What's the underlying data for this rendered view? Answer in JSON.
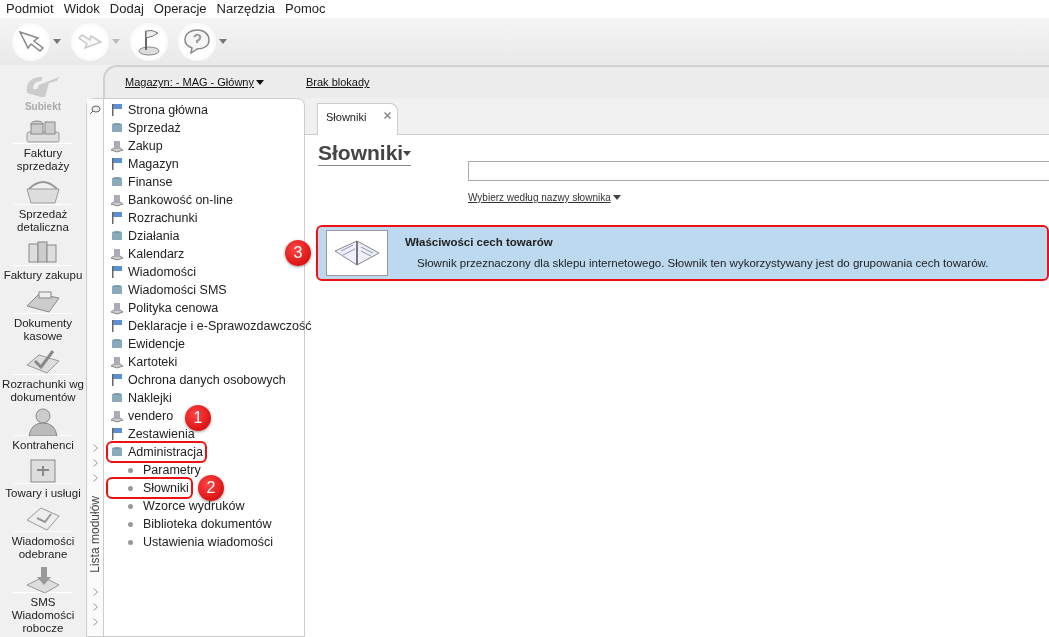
{
  "menu": [
    {
      "label": "Podmiot"
    },
    {
      "label": "Widok"
    },
    {
      "label": "Dodaj"
    },
    {
      "label": "Operacje"
    },
    {
      "label": "Narzędzia"
    },
    {
      "label": "Pomoc"
    }
  ],
  "toolbar": [
    {
      "kind": "back",
      "disabled": false,
      "has_menu": true
    },
    {
      "kind": "forward",
      "disabled": true,
      "has_menu": true
    },
    {
      "kind": "flag",
      "disabled": false,
      "has_menu": false
    },
    {
      "kind": "help",
      "disabled": false,
      "has_menu": true
    }
  ],
  "app_logo": {
    "label": "Subiekt"
  },
  "header": {
    "warehouse": "Magazyn: - MAG - Główny",
    "lock": "Brak blokady"
  },
  "shortcuts": [
    {
      "label": "Faktury sprzedaży",
      "kind": "coins"
    },
    {
      "label": "Sprzedaż detaliczna",
      "kind": "basket"
    },
    {
      "label": "Faktury zakupu",
      "kind": "books"
    },
    {
      "label": "Dokumenty kasowe",
      "kind": "register"
    },
    {
      "label": "Rozrachunki wg dokumentów",
      "kind": "check"
    },
    {
      "label": "Kontrahenci",
      "kind": "person"
    },
    {
      "label": "Towary i usługi",
      "kind": "box"
    },
    {
      "label": "Wiadomości odebrane",
      "kind": "mail"
    },
    {
      "label": "SMS Wiadomości robocze",
      "kind": "sms"
    }
  ],
  "module_panel": {
    "title": "Lista modułów",
    "items": [
      {
        "label": "Strona główna"
      },
      {
        "label": "Sprzedaż"
      },
      {
        "label": "Zakup"
      },
      {
        "label": "Magazyn"
      },
      {
        "label": "Finanse"
      },
      {
        "label": "Bankowość on-line"
      },
      {
        "label": "Rozrachunki"
      },
      {
        "label": "Działania"
      },
      {
        "label": "Kalendarz"
      },
      {
        "label": "Wiadomości"
      },
      {
        "label": "Wiadomości SMS"
      },
      {
        "label": "Polityka cenowa"
      },
      {
        "label": "Deklaracje i e-Sprawozdawczość"
      },
      {
        "label": "Ewidencje"
      },
      {
        "label": "Kartoteki"
      },
      {
        "label": "Ochrona danych osobowych"
      },
      {
        "label": "Naklejki"
      },
      {
        "label": "vendero"
      },
      {
        "label": "Zestawienia"
      },
      {
        "label": "Administracja",
        "annotation": "1",
        "children": [
          {
            "label": "Parametry"
          },
          {
            "label": "Słowniki",
            "annotation": "2"
          },
          {
            "label": "Wzorce wydruków"
          },
          {
            "label": "Biblioteka dokumentów"
          },
          {
            "label": "Ustawienia wiadomości"
          }
        ]
      }
    ]
  },
  "tabs": [
    {
      "label": "Słowniki",
      "selected": true
    }
  ],
  "page": {
    "title": "Słowniki",
    "filter": "Wybierz według nazwy słownika"
  },
  "dictionaries": [
    {
      "title": "Właściwości cech towarów",
      "description": "Słownik przeznaczony dla sklepu internetowego. Słownik ten wykorzystywany jest do grupowania cech towarów.",
      "selected": true,
      "annotation": "3"
    }
  ]
}
